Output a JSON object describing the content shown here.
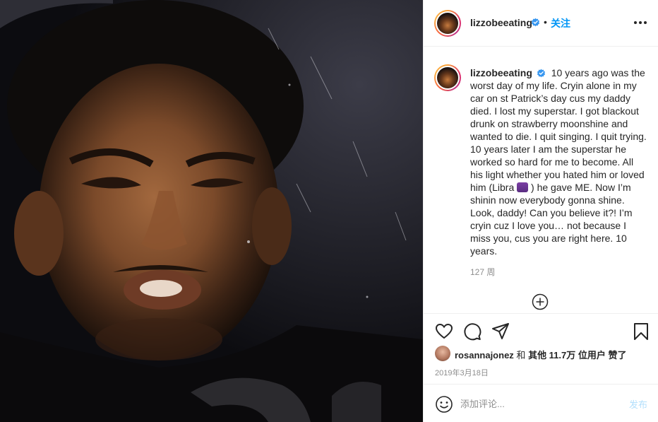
{
  "post": {
    "username": "lizzobeeating",
    "follow_label": "关注",
    "separator": "•",
    "caption": "10 years ago was the worst day of my life. Cryin alone in my car on st Patrick’s day cus my daddy died. I lost my superstar. I got blackout drunk on strawberry moonshine and wanted to die. I quit singing. I quit trying. 10 years later I am the superstar he worked so hard for me to become. All his light whether you hated him or loved him (Libra",
    "caption_after_emoji": ") he gave ME. Now I’m shinin now everybody gonna shine. Look, daddy! Can you believe it?! I’m cryin cuz I love you… not because I miss you, cus you are right here. 10 years.",
    "time_ago": "127 周",
    "date": "2019年3月18日"
  },
  "likes": {
    "user": "rosannajonez",
    "and": "和",
    "others": "其他 11.7万 位用户",
    "suffix": "赞了"
  },
  "comment": {
    "placeholder": "添加评论...",
    "post_label": "发布"
  },
  "icons": {
    "verified": "verified-badge-icon",
    "more": "more-options-icon",
    "load_more": "plus-circle-icon",
    "like": "heart-icon",
    "comment": "comment-bubble-icon",
    "share": "paper-plane-icon",
    "save": "bookmark-icon",
    "emoji": "smiley-icon"
  },
  "colors": {
    "accent": "#0095f6",
    "verified": "#3897f0",
    "muted": "#8e8e8e",
    "post_disabled": "#b2dffc"
  }
}
